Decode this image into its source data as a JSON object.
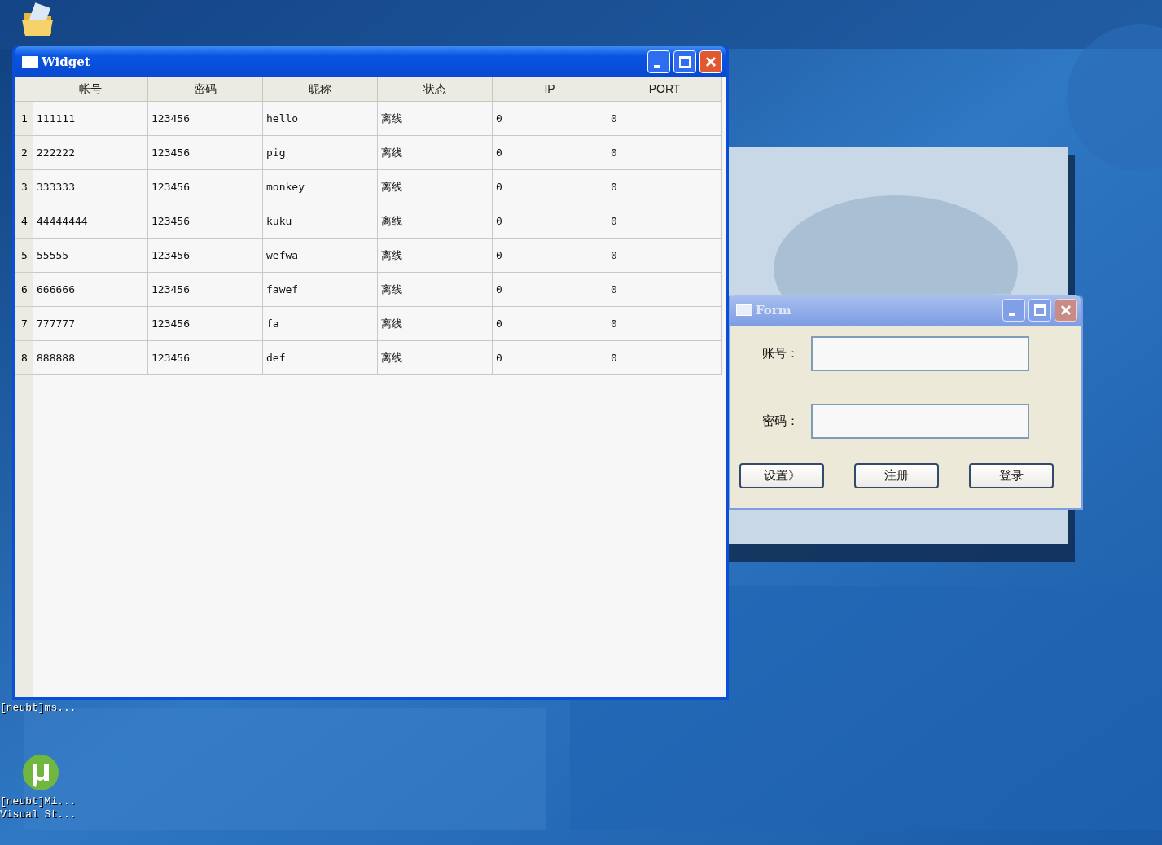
{
  "desktop_icons": [
    {
      "kind": "folder"
    },
    {
      "kind": "none",
      "label": "[neubt]ms..."
    },
    {
      "kind": "app",
      "label": "[neubt]Mi..."
    },
    {
      "kind": "none",
      "label": "Visual St..."
    }
  ],
  "widget_window": {
    "title": "Widget",
    "active": true,
    "table": {
      "columns": [
        "帐号",
        "密码",
        "昵称",
        "状态",
        "IP",
        "PORT"
      ],
      "rows": [
        {
          "number": "1",
          "cells": [
            "111111",
            "123456",
            "hello",
            "离线",
            "0",
            "0"
          ]
        },
        {
          "number": "2",
          "cells": [
            "222222",
            "123456",
            "pig",
            "离线",
            "0",
            "0"
          ]
        },
        {
          "number": "3",
          "cells": [
            "333333",
            "123456",
            "monkey",
            "离线",
            "0",
            "0"
          ]
        },
        {
          "number": "4",
          "cells": [
            "44444444",
            "123456",
            "kuku",
            "离线",
            "0",
            "0"
          ]
        },
        {
          "number": "5",
          "cells": [
            "55555",
            "123456",
            "wefwa",
            "离线",
            "0",
            "0"
          ]
        },
        {
          "number": "6",
          "cells": [
            "666666",
            "123456",
            "fawef",
            "离线",
            "0",
            "0"
          ]
        },
        {
          "number": "7",
          "cells": [
            "777777",
            "123456",
            "fa",
            "离线",
            "0",
            "0"
          ]
        },
        {
          "number": "8",
          "cells": [
            "888888",
            "123456",
            "def",
            "离线",
            "0",
            "0"
          ]
        }
      ]
    }
  },
  "form_window": {
    "title": "Form",
    "active": false,
    "fields": [
      {
        "label": "账号："
      },
      {
        "label": "密码："
      }
    ],
    "buttons": [
      "设置》",
      "注册",
      "登录"
    ]
  }
}
